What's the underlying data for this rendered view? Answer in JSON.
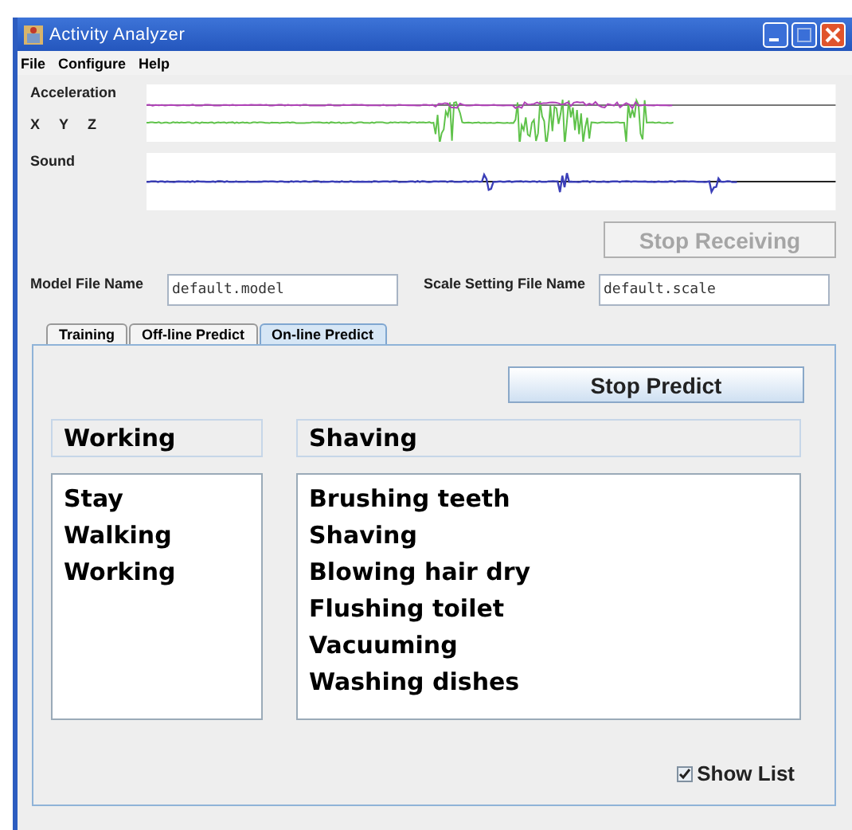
{
  "window": {
    "title": "Activity Analyzer"
  },
  "menu": [
    "File",
    "Configure",
    "Help"
  ],
  "sensors": {
    "acceleration_label": "Acceleration",
    "axes": [
      "X",
      "Y",
      "Z"
    ],
    "sound_label": "Sound"
  },
  "receive_button": {
    "label": "Stop Receiving",
    "disabled": true
  },
  "model_file": {
    "label": "Model File Name",
    "value": "default.model"
  },
  "scale_file": {
    "label": "Scale Setting File Name",
    "value": "default.scale"
  },
  "tabs": [
    {
      "label": "Training",
      "selected": false
    },
    {
      "label": "Off-line Predict",
      "selected": false
    },
    {
      "label": "On-line Predict",
      "selected": true
    }
  ],
  "predict_button": {
    "label": "Stop Predict",
    "disabled": false
  },
  "current_state": "Working",
  "current_activity": "Shaving",
  "states": [
    "Stay",
    "Walking",
    "Working"
  ],
  "activities": [
    "Brushing teeth",
    "Shaving",
    "Blowing hair dry",
    "Flushing toilet",
    "Vacuuming",
    "Washing dishes"
  ],
  "show_list": {
    "label": "Show List",
    "checked": true
  }
}
